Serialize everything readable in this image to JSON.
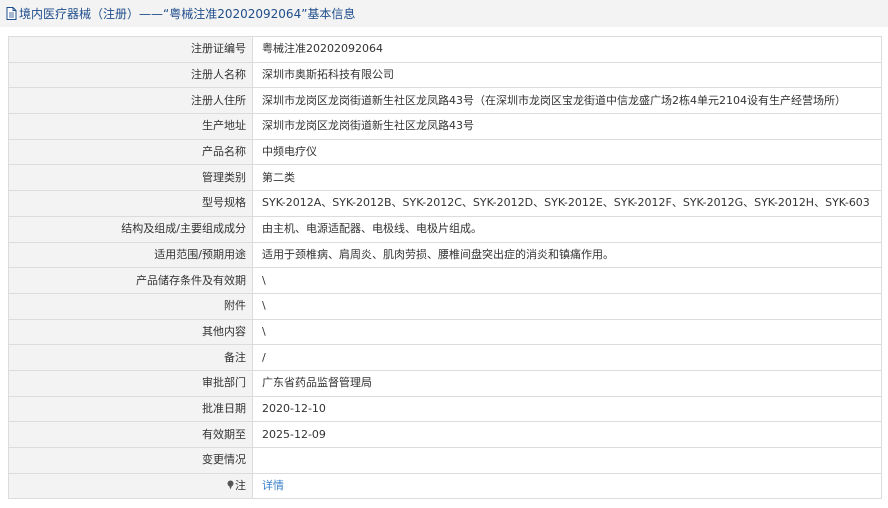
{
  "header": {
    "title": "境内医疗器械（注册）——“粤械注准20202092064”基本信息",
    "icon": "document-icon"
  },
  "rows": [
    {
      "label": "注册证编号",
      "value": "粤械注准20202092064"
    },
    {
      "label": "注册人名称",
      "value": "深圳市奥斯拓科技有限公司"
    },
    {
      "label": "注册人住所",
      "value": "深圳市龙岗区龙岗街道新生社区龙凤路43号（在深圳市龙岗区宝龙街道中信龙盛广场2栋4单元2104设有生产经营场所）"
    },
    {
      "label": "生产地址",
      "value": "深圳市龙岗区龙岗街道新生社区龙凤路43号"
    },
    {
      "label": "产品名称",
      "value": "中频电疗仪"
    },
    {
      "label": "管理类别",
      "value": "第二类"
    },
    {
      "label": "型号规格",
      "value": "SYK-2012A、SYK-2012B、SYK-2012C、SYK-2012D、SYK-2012E、SYK-2012F、SYK-2012G、SYK-2012H、SYK-603"
    },
    {
      "label": "结构及组成/主要组成成分",
      "value": "由主机、电源适配器、电极线、电极片组成。"
    },
    {
      "label": "适用范围/预期用途",
      "value": "适用于颈椎病、肩周炎、肌肉劳损、腰椎间盘突出症的消炎和镇痛作用。"
    },
    {
      "label": "产品储存条件及有效期",
      "value": "\\"
    },
    {
      "label": "附件",
      "value": "\\"
    },
    {
      "label": "其他内容",
      "value": "\\"
    },
    {
      "label": "备注",
      "value": "/"
    },
    {
      "label": "审批部门",
      "value": "广东省药品监督管理局"
    },
    {
      "label": "批准日期",
      "value": "2020-12-10"
    },
    {
      "label": "有效期至",
      "value": "2025-12-09"
    },
    {
      "label": "变更情况",
      "value": ""
    }
  ],
  "note_row": {
    "label": "注",
    "icon": "pin-icon",
    "link_text": "详情",
    "link_color": "#3a7fc9"
  }
}
